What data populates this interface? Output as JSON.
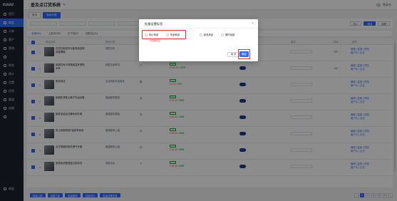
{
  "sidebar": {
    "logo": "cuuu",
    "items": [
      {
        "label": "首页",
        "active": false
      },
      {
        "label": "商品",
        "active": true
      },
      {
        "label": "订单",
        "active": false
      },
      {
        "label": "客户",
        "active": false
      },
      {
        "label": "营销",
        "active": false
      },
      {
        "label": "",
        "active": false
      },
      {
        "label": "财务",
        "active": false
      },
      {
        "label": "统计",
        "active": false
      },
      {
        "label": "设置",
        "active": false
      },
      {
        "label": "应用",
        "active": false
      },
      {
        "label": "渠道",
        "active": false
      },
      {
        "label": "店铺",
        "active": false
      },
      {
        "label": "",
        "active": false
      }
    ],
    "bottom_label": "收起"
  },
  "header": {
    "title": "查及点订货系统",
    "user": "登录名"
  },
  "crumbs": [
    "首页",
    "商品列表"
  ],
  "filter": {
    "search_btn": "筛选",
    "reset_btn": "重置",
    "export_btn": "导入"
  },
  "tabs": [
    {
      "label": "全部(88)",
      "active": true
    },
    {
      "label": "上架中(86)",
      "active": false
    },
    {
      "label": "已下架(2)",
      "active": false
    },
    {
      "label": "回收站(41)",
      "active": false
    }
  ],
  "table": {
    "headers": [
      "商品名称",
      "商品分类",
      "单位",
      "价格/库存",
      "上下架",
      "库存",
      "排序",
      "操作"
    ],
    "rows": [
      {
        "idx": "1",
        "name": "百货日用品多功能收纳盒家用整理箱",
        "cat": "家居日用",
        "unit": "个",
        "price": "¥ 199.00",
        "stock": "8888",
        "sort": "100",
        "a1": "编辑 | 复制 | 预览",
        "a2": "客户价 | 日志"
      },
      {
        "idx": "2",
        "name": "新款时尚不锈钢保温杯便携水杯",
        "cat": "家居日用/杯具",
        "unit": "个",
        "price": "¥ 100.00",
        "stock": "5000",
        "sort": "100",
        "a1": "编辑 | 复制 | 预览",
        "a2": "客户价 | 日志"
      },
      {
        "idx": "3",
        "name": "家用清洁",
        "cat": "生活用品/清洁用品",
        "unit": "瓶",
        "price": "¥ 2.00",
        "stock": "999",
        "sort": "",
        "a1": "编辑 | 复制 | 预览",
        "a2": "客户价 | 日志"
      },
      {
        "idx": "4",
        "name": "耐磨防滑登山鞋户外运动鞋",
        "cat": "服装鞋帽/鞋类",
        "unit": "双",
        "price": "¥ 28.00",
        "stock": "8888",
        "sort": "",
        "a1": "编辑 | 复制 | 预览",
        "a2": "客户价 | 日志"
      },
      {
        "idx": "5",
        "name": "新款加绒运动裤休闲长裤",
        "cat": "服装鞋帽/裤装",
        "unit": "件",
        "price": "¥ 28.00",
        "stock": "8888",
        "sort": "",
        "a1": "编辑 | 复制 | 预览",
        "a2": "客户价 | 日志"
      },
      {
        "idx": "6",
        "name": "男士纯棉短袖T恤夏季休闲",
        "cat": "服装鞋帽/上装",
        "unit": "件",
        "price": "¥ 28.00",
        "stock": "8888",
        "sort": "",
        "a1": "编辑 | 复制 | 预览",
        "a2": "客户价 | 日志"
      },
      {
        "idx": "7",
        "name": "女式薄款防晒衣透气外套",
        "cat": "服装鞋帽/上装",
        "unit": "件",
        "price": "¥ 28.00",
        "stock": "8888",
        "sort": "",
        "a1": "编辑 | 复制 | 预览",
        "a2": "客户价 | 日志"
      },
      {
        "idx": "8",
        "name": "家居收纳整理盒日用杂货",
        "cat": "家居日用",
        "unit": "个",
        "price": "¥ 28.00",
        "stock": "8888",
        "sort": "",
        "a1": "编辑 | 复制 | 预览",
        "a2": "客户价 | 日志"
      }
    ]
  },
  "bottom": {
    "buttons": [
      "批量上架",
      "批量下架",
      "批量删除",
      "批量改价",
      "批量设置标签"
    ],
    "pages": [
      "1",
      "2",
      "3",
      "4",
      "5"
    ]
  },
  "modal": {
    "title": "批量设置标签",
    "opt1": "特价商品",
    "opt2": "热销商品",
    "opt3": "新品商品",
    "opt4": "限时促销",
    "hint": "请选择标签",
    "cancel": "取消",
    "ok": "确定"
  }
}
